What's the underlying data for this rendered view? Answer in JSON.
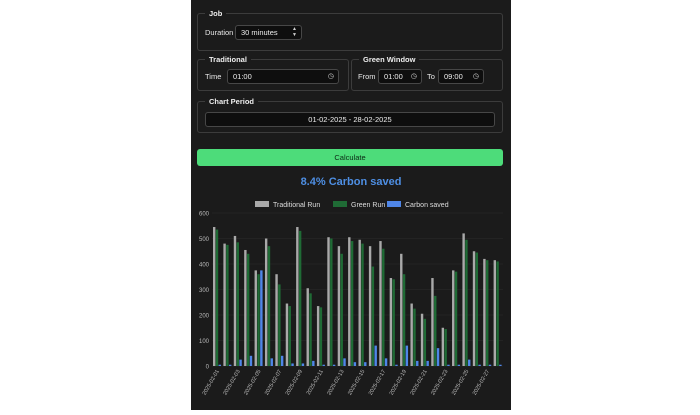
{
  "job": {
    "legend": "Job",
    "duration_label": "Duration",
    "duration_value": "30 minutes"
  },
  "traditional": {
    "legend": "Traditional",
    "time_label": "Time",
    "time_value": "01:00"
  },
  "green_window": {
    "legend": "Green Window",
    "from_label": "From",
    "from_value": "01:00",
    "to_label": "To",
    "to_value": "09:00"
  },
  "chart_period": {
    "legend": "Chart Period",
    "value": "01-02-2025 - 28-02-2025"
  },
  "calculate_label": "Calculate",
  "result_headline": "8.4% Carbon saved",
  "colors": {
    "traditional": "#a9a9a9",
    "green": "#1f6b35",
    "carbon": "#4f86e8",
    "button": "#4ddc7a",
    "headline": "#4e8fe4"
  },
  "chart_data": {
    "type": "bar",
    "legend_position": "top",
    "ylim": [
      0,
      600
    ],
    "yticks": [
      0,
      100,
      200,
      300,
      400,
      500,
      600
    ],
    "categories": [
      "2025-02-01",
      "2025-02-02",
      "2025-02-03",
      "2025-02-04",
      "2025-02-05",
      "2025-02-06",
      "2025-02-07",
      "2025-02-08",
      "2025-02-09",
      "2025-02-10",
      "2025-02-11",
      "2025-02-12",
      "2025-02-13",
      "2025-02-14",
      "2025-02-15",
      "2025-02-16",
      "2025-02-17",
      "2025-02-18",
      "2025-02-19",
      "2025-02-20",
      "2025-02-21",
      "2025-02-22",
      "2025-02-23",
      "2025-02-24",
      "2025-02-25",
      "2025-02-26",
      "2025-02-27",
      "2025-02-28"
    ],
    "xtick_labels": [
      "2025-02-01",
      "2025-02-03",
      "2025-02-05",
      "2025-02-07",
      "2025-02-09",
      "2025-02-11",
      "2025-02-13",
      "2025-02-15",
      "2025-02-17",
      "2025-02-19",
      "2025-02-21",
      "2025-02-23",
      "2025-02-25",
      "2025-02-27"
    ],
    "series": [
      {
        "name": "Traditional Run",
        "values": [
          545,
          480,
          510,
          455,
          375,
          500,
          360,
          245,
          545,
          305,
          235,
          505,
          470,
          505,
          495,
          470,
          490,
          345,
          440,
          245,
          205,
          345,
          150,
          375,
          520,
          450,
          420,
          415
        ]
      },
      {
        "name": "Green Run",
        "values": [
          535,
          475,
          485,
          440,
          360,
          470,
          320,
          235,
          530,
          285,
          230,
          500,
          440,
          490,
          480,
          390,
          460,
          340,
          360,
          225,
          185,
          275,
          145,
          370,
          495,
          445,
          415,
          410
        ]
      },
      {
        "name": "Carbon saved",
        "values": [
          5,
          5,
          25,
          40,
          375,
          30,
          40,
          10,
          10,
          20,
          5,
          5,
          30,
          15,
          15,
          80,
          30,
          5,
          80,
          20,
          20,
          70,
          5,
          5,
          25,
          5,
          5,
          5
        ]
      }
    ]
  }
}
